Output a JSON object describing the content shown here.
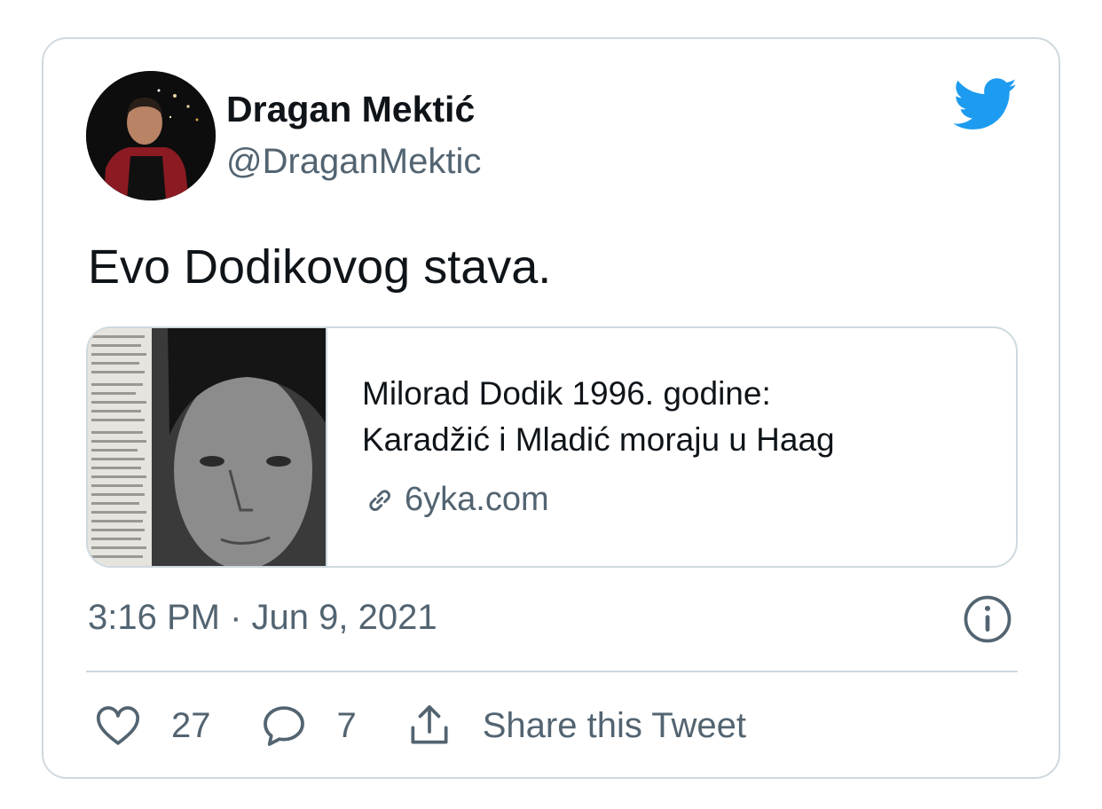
{
  "user": {
    "display_name": "Dragan Mektić",
    "handle": "@DraganMektic"
  },
  "tweet": {
    "text": "Evo Dodikovog stava.",
    "timestamp": "3:16 PM · Jun 9, 2021"
  },
  "link_card": {
    "title_line1": "Milorad Dodik 1996. godine:",
    "title_line2": "Karadžić i Mladić moraju u Haag",
    "domain": "6yka.com"
  },
  "actions": {
    "likes": "27",
    "replies": "7",
    "share_label": "Share this Tweet"
  },
  "icons": [
    "twitter-bird-icon",
    "link-icon",
    "info-icon",
    "heart-icon",
    "reply-icon",
    "share-icon"
  ],
  "colors": {
    "brand": "#1d9bf0",
    "text": "#0f1419",
    "secondary": "#536471",
    "border": "#cfd9de"
  }
}
